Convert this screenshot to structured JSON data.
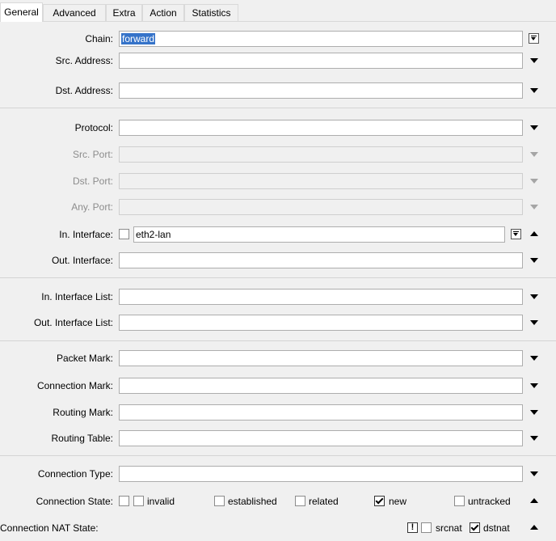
{
  "tabs": [
    "General",
    "Advanced",
    "Extra",
    "Action",
    "Statistics"
  ],
  "fields": {
    "chain": {
      "label": "Chain:",
      "value": "forward"
    },
    "src_address": {
      "label": "Src. Address:"
    },
    "dst_address": {
      "label": "Dst. Address:"
    },
    "protocol": {
      "label": "Protocol:"
    },
    "src_port": {
      "label": "Src. Port:"
    },
    "dst_port": {
      "label": "Dst. Port:"
    },
    "any_port": {
      "label": "Any. Port:"
    },
    "in_interface": {
      "label": "In. Interface:",
      "value": "eth2-lan",
      "negate_checked": false
    },
    "out_interface": {
      "label": "Out. Interface:"
    },
    "in_interface_list": {
      "label": "In. Interface List:"
    },
    "out_interface_list": {
      "label": "Out. Interface List:"
    },
    "packet_mark": {
      "label": "Packet Mark:"
    },
    "connection_mark": {
      "label": "Connection Mark:"
    },
    "routing_mark": {
      "label": "Routing Mark:"
    },
    "routing_table": {
      "label": "Routing Table:"
    },
    "connection_type": {
      "label": "Connection Type:"
    }
  },
  "connection_state": {
    "label": "Connection State:",
    "negate_checked": false,
    "options": [
      {
        "label": "invalid",
        "checked": false
      },
      {
        "label": "established",
        "checked": false
      },
      {
        "label": "related",
        "checked": false
      },
      {
        "label": "new",
        "checked": true
      },
      {
        "label": "untracked",
        "checked": false
      }
    ]
  },
  "connection_nat_state": {
    "label": "Connection NAT State:",
    "negate_symbol": "!",
    "options": [
      {
        "label": "srcnat",
        "checked": false
      },
      {
        "label": "dstnat",
        "checked": true
      }
    ]
  }
}
